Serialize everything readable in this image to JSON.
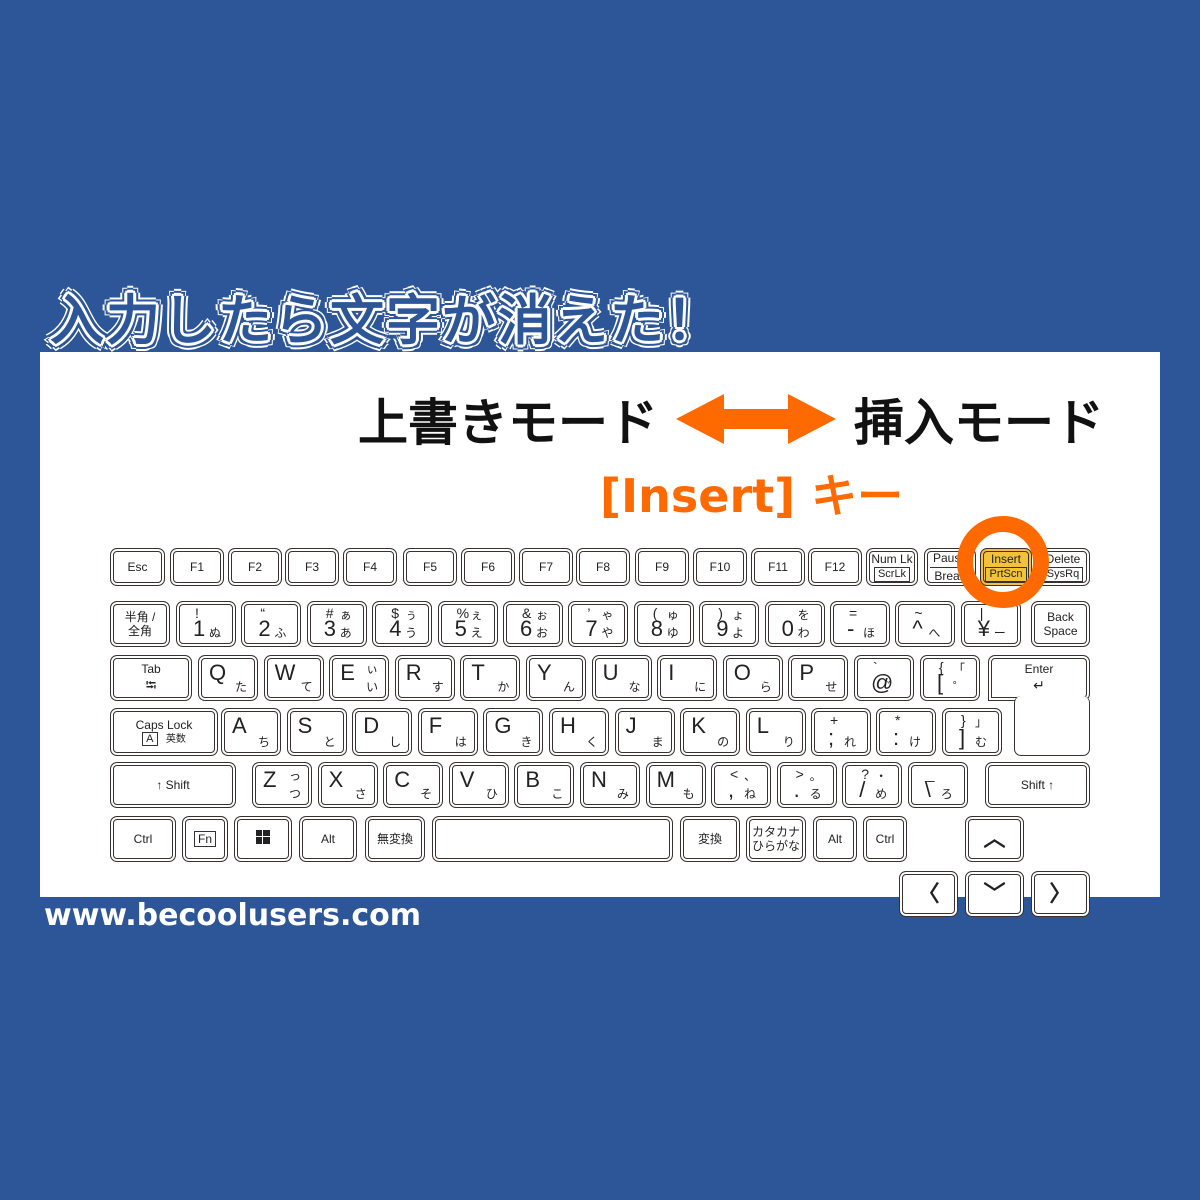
{
  "headline": "入力したら文字が消えた！",
  "modes": {
    "left": "上書きモード",
    "right": "挿入モード",
    "arrow_icon": "double-headed-arrow",
    "key_label": "[Insert] キー"
  },
  "website": "www.becoolusers.com",
  "colors": {
    "background": "#2c5697",
    "accent": "#ff6a00",
    "highlight_key": "#f4c13a"
  },
  "keyboard": {
    "fn_row": [
      "Esc",
      "F1",
      "F2",
      "F3",
      "F4",
      "F5",
      "F6",
      "F7",
      "F8",
      "F9",
      "F10",
      "F11",
      "F12"
    ],
    "numlk": {
      "top": "Num Lk",
      "bottom": "ScrLk"
    },
    "pause": {
      "top": "Pause",
      "bottom": "Break"
    },
    "insert": {
      "top": "Insert",
      "bottom": "PrtScn"
    },
    "delete": {
      "top": "Delete",
      "bottom": "SysRq"
    },
    "hankaku": {
      "line1": "半角 /",
      "line2": "全角"
    },
    "number_row": [
      {
        "sym": "!",
        "num": "1",
        "kana": "ぬ",
        "kana_top": ""
      },
      {
        "sym": "“",
        "num": "2",
        "kana": "ふ",
        "kana_top": ""
      },
      {
        "sym": "#",
        "num": "3",
        "kana": "あ",
        "kana_top": "ぁ"
      },
      {
        "sym": "$",
        "num": "4",
        "kana": "う",
        "kana_top": "ぅ"
      },
      {
        "sym": "%",
        "num": "5",
        "kana": "え",
        "kana_top": "ぇ"
      },
      {
        "sym": "&",
        "num": "6",
        "kana": "お",
        "kana_top": "ぉ"
      },
      {
        "sym": "’",
        "num": "7",
        "kana": "や",
        "kana_top": "ゃ"
      },
      {
        "sym": "(",
        "num": "8",
        "kana": "ゆ",
        "kana_top": "ゅ"
      },
      {
        "sym": ")",
        "num": "9",
        "kana": "よ",
        "kana_top": "ょ"
      },
      {
        "sym": "",
        "num": "0",
        "kana": "わ",
        "kana_top": "を"
      },
      {
        "sym": "=",
        "num": "-",
        "kana": "ほ",
        "kana_top": ""
      },
      {
        "sym": "~",
        "num": "^",
        "kana": "へ",
        "kana_top": ""
      },
      {
        "sym": "|",
        "num": "¥",
        "kana": "ー",
        "kana_top": ""
      }
    ],
    "backspace": {
      "line1": "Back",
      "line2": "Space"
    },
    "tab": {
      "label": "Tab",
      "icon": "tab-arrows"
    },
    "q_row": [
      {
        "alpha": "Q",
        "kana": "た"
      },
      {
        "alpha": "W",
        "kana": "て"
      },
      {
        "alpha": "E",
        "kana": "い",
        "kana_top": "ぃ"
      },
      {
        "alpha": "R",
        "kana": "す"
      },
      {
        "alpha": "T",
        "kana": "か"
      },
      {
        "alpha": "Y",
        "kana": "ん"
      },
      {
        "alpha": "U",
        "kana": "な"
      },
      {
        "alpha": "I",
        "kana": "に"
      },
      {
        "alpha": "O",
        "kana": "ら"
      },
      {
        "alpha": "P",
        "kana": "せ"
      }
    ],
    "at_key": {
      "top": "`",
      "bottom": "@",
      "kana": "゛"
    },
    "bracket_key": {
      "top": "{",
      "bottom": "[",
      "kana_top": "「",
      "kana": "゜"
    },
    "enter": {
      "label": "Enter",
      "icon": "enter-arrow"
    },
    "capslock": {
      "line1": "Caps Lock",
      "box": "A",
      "sub": "英数"
    },
    "a_row": [
      {
        "alpha": "A",
        "kana": "ち"
      },
      {
        "alpha": "S",
        "kana": "と"
      },
      {
        "alpha": "D",
        "kana": "し"
      },
      {
        "alpha": "F",
        "kana": "は"
      },
      {
        "alpha": "G",
        "kana": "き"
      },
      {
        "alpha": "H",
        "kana": "く"
      },
      {
        "alpha": "J",
        "kana": "ま"
      },
      {
        "alpha": "K",
        "kana": "の"
      },
      {
        "alpha": "L",
        "kana": "り"
      }
    ],
    "semicolon_key": {
      "top": "+",
      "bottom": ";",
      "kana": "れ"
    },
    "colon_key": {
      "top": "*",
      "bottom": ":",
      "kana": "け"
    },
    "rbracket_key": {
      "top": "}",
      "bottom": "]",
      "kana_top": "」",
      "kana": "む"
    },
    "shift_left": "↑ Shift",
    "z_row": [
      {
        "alpha": "Z",
        "kana": "つ",
        "kana_top": "っ"
      },
      {
        "alpha": "X",
        "kana": "さ"
      },
      {
        "alpha": "C",
        "kana": "そ"
      },
      {
        "alpha": "V",
        "kana": "ひ"
      },
      {
        "alpha": "B",
        "kana": "こ"
      },
      {
        "alpha": "N",
        "kana": "み"
      },
      {
        "alpha": "M",
        "kana": "も"
      }
    ],
    "comma_key": {
      "top": "<",
      "bottom": ",",
      "kana_top": "、",
      "kana": "ね"
    },
    "period_key": {
      "top": ">",
      "bottom": ".",
      "kana_top": "。",
      "kana": "る"
    },
    "slash_key": {
      "top": "?",
      "bottom": "/",
      "kana_top": "・",
      "kana": "め"
    },
    "backslash_key": {
      "top": "_",
      "bottom": "\\",
      "kana": "ろ"
    },
    "shift_right": "Shift ↑",
    "bottom_row": {
      "ctrl_left": "Ctrl",
      "fn": "Fn",
      "win_icon": "windows-logo",
      "alt_left": "Alt",
      "muhenkan": "無変換",
      "space": "",
      "henkan": "変換",
      "kana_line1": "カタカナ",
      "kana_line2": "ひらがな",
      "alt_right": "Alt",
      "ctrl_right": "Ctrl"
    },
    "arrows": {
      "up": "︿",
      "left": "〈",
      "down": "﹀",
      "right": "〉"
    }
  }
}
